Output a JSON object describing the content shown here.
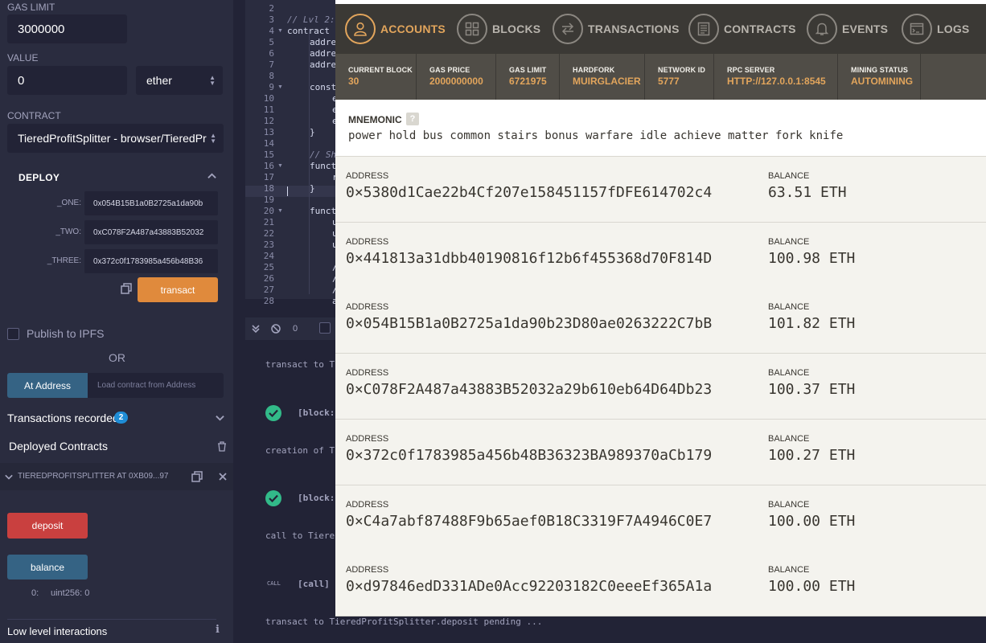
{
  "remix": {
    "gas_limit_label": "GAS LIMIT",
    "gas_limit_value": "3000000",
    "value_label": "VALUE",
    "value_value": "0",
    "value_unit": "ether",
    "contract_label": "CONTRACT",
    "contract_value": "TieredProfitSplitter - browser/TieredPr",
    "deploy_label": "DEPLOY",
    "params": [
      {
        "label": "_ONE:",
        "value": "0x054B15B1a0B2725a1da90b"
      },
      {
        "label": "_TWO:",
        "value": "0xC078F2A487a43883B52032"
      },
      {
        "label": "_THREE:",
        "value": "0x372c0f1783985a456b48B36"
      }
    ],
    "transact_label": "transact",
    "publish_label": "Publish to IPFS",
    "or_label": "OR",
    "at_address_label": "At Address",
    "load_contract_placeholder": "Load contract from Address",
    "transactions_label": "Transactions recorded",
    "transactions_count": "2",
    "deployed_label": "Deployed Contracts",
    "instance_label": "TIEREDPROFITSPLITTER AT 0XB09...97",
    "deposit_label": "deposit",
    "balance_label": "balance",
    "balance_index": "0:",
    "balance_output": "uint256: 0",
    "low_level_label": "Low level interactions",
    "accent_orange": "#e08a3c",
    "accent_red": "#c9403f",
    "accent_blue": "#356384"
  },
  "editor": {
    "line_numbers": [
      "2",
      "3",
      "4",
      "5",
      "6",
      "7",
      "8",
      "9",
      "10",
      "11",
      "12",
      "13",
      "14",
      "15",
      "16",
      "17",
      "18",
      "19",
      "20",
      "21",
      "22",
      "23",
      "24",
      "25",
      "26",
      "27",
      "28"
    ],
    "lines": [
      "",
      "// Lvl 2:",
      "contract",
      "addre",
      "addre",
      "addre",
      "",
      "const",
      "e",
      "e",
      "e",
      "}",
      "",
      "// Sh",
      "funct",
      "r",
      "}",
      "",
      "funct",
      "u",
      "u",
      "u",
      "",
      "/",
      "/",
      "/",
      "a"
    ]
  },
  "terminal": {
    "pending_count": "0",
    "entries": [
      "transact to Ti",
      "[block:",
      "creation of T",
      "[block:",
      "call to Tiere",
      "CALL",
      "[call]",
      "transact to TieredProfitSplitter.deposit pending ..."
    ]
  },
  "ganache": {
    "nav": [
      {
        "label": "ACCOUNTS",
        "icon": "user-icon",
        "active": true
      },
      {
        "label": "BLOCKS",
        "icon": "blocks-icon",
        "active": false
      },
      {
        "label": "TRANSACTIONS",
        "icon": "transactions-icon",
        "active": false
      },
      {
        "label": "CONTRACTS",
        "icon": "contracts-icon",
        "active": false
      },
      {
        "label": "EVENTS",
        "icon": "bell-icon",
        "active": false
      },
      {
        "label": "LOGS",
        "icon": "logs-icon",
        "active": false
      }
    ],
    "stats": [
      {
        "label": "CURRENT BLOCK",
        "value": "30"
      },
      {
        "label": "GAS PRICE",
        "value": "2000000000"
      },
      {
        "label": "GAS LIMIT",
        "value": "6721975"
      },
      {
        "label": "HARDFORK",
        "value": "MUIRGLACIER"
      },
      {
        "label": "NETWORK ID",
        "value": "5777"
      },
      {
        "label": "RPC SERVER",
        "value": "HTTP://127.0.0.1:8545"
      },
      {
        "label": "MINING STATUS",
        "value": "AUTOMINING"
      }
    ],
    "mnemonic_label": "MNEMONIC",
    "mnemonic_help": "?",
    "mnemonic": "power hold bus common stairs bonus warfare idle achieve matter fork knife",
    "address_label": "ADDRESS",
    "balance_label": "BALANCE",
    "accounts": [
      {
        "address": "0×5380d1Cae22b4Cf207e158451157fDFE614702c4",
        "balance": "63.51 ETH"
      },
      {
        "address": "0×441813a31dbb40190816f12b6f455368d70F814D",
        "balance": "100.98 ETH"
      },
      {
        "address": "0×054B15B1a0B2725a1da90b23D80ae0263222C7bB",
        "balance": "101.82 ETH"
      },
      {
        "address": "0×C078F2A487a43883B52032a29b610eb64D64Db23",
        "balance": "100.37 ETH"
      },
      {
        "address": "0×372c0f1783985a456b48B36323BA989370aCb179",
        "balance": "100.27 ETH"
      },
      {
        "address": "0×C4a7abf87488F9b65aef0B18C3319F7A4946C0E7",
        "balance": "100.00 ETH"
      },
      {
        "address": "0×d97846edD331ADe0Acc92203182C0eeeEf365A1a",
        "balance": "100.00 ETH"
      }
    ],
    "accent": "#e2a55c"
  }
}
